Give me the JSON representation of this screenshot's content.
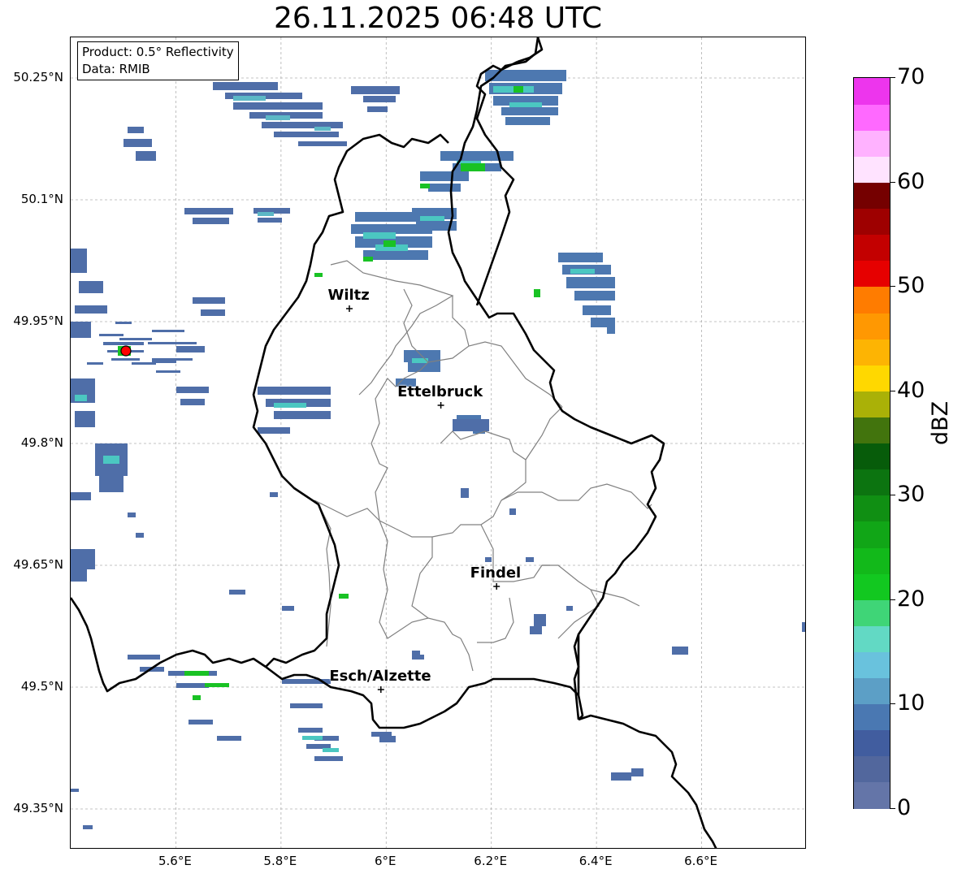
{
  "title": "26.11.2025 06:48 UTC",
  "info": {
    "product": "Product: 0.5° Reflectivity",
    "data": "Data: RMIB"
  },
  "axes": {
    "lat_ticks": [
      {
        "value": 50.25,
        "label": "50.25°N"
      },
      {
        "value": 50.1,
        "label": "50.1°N"
      },
      {
        "value": 49.95,
        "label": "49.95°N"
      },
      {
        "value": 49.8,
        "label": "49.8°N"
      },
      {
        "value": 49.65,
        "label": "49.65°N"
      },
      {
        "value": 49.5,
        "label": "49.5°N"
      },
      {
        "value": 49.35,
        "label": "49.35°N"
      }
    ],
    "lon_ticks": [
      {
        "value": 5.6,
        "label": "5.6°E"
      },
      {
        "value": 5.8,
        "label": "5.8°E"
      },
      {
        "value": 6.0,
        "label": "6°E"
      },
      {
        "value": 6.2,
        "label": "6.2°E"
      },
      {
        "value": 6.4,
        "label": "6.4°E"
      },
      {
        "value": 6.6,
        "label": "6.6°E"
      }
    ],
    "lon_range": [
      5.4,
      6.8
    ],
    "lat_range": [
      49.3,
      50.3
    ],
    "grid": true
  },
  "cities": [
    {
      "name": "Wiltz",
      "lon": 5.93,
      "lat": 49.966
    },
    {
      "name": "Ettelbruck",
      "lon": 6.104,
      "lat": 49.847
    },
    {
      "name": "Findel",
      "lon": 6.21,
      "lat": 49.624
    },
    {
      "name": "Esch/Alzette",
      "lon": 5.99,
      "lat": 49.497
    }
  ],
  "radar_site": {
    "lon": 5.505,
    "lat": 49.914,
    "color": "#ff0000"
  },
  "colorbar": {
    "label": "dBZ",
    "min": 0,
    "max": 70,
    "ticks": [
      "0",
      "10",
      "20",
      "30",
      "40",
      "50",
      "60",
      "70"
    ],
    "colors": [
      "#6475a8",
      "#52679d",
      "#415d9f",
      "#4a78b2",
      "#5c9fc6",
      "#69c2dd",
      "#62d9c4",
      "#3fd577",
      "#12c820",
      "#12b91a",
      "#11a617",
      "#108f13",
      "#0c7410",
      "#075c0a",
      "#42740d",
      "#aab107",
      "#ffd800",
      "#fdb403",
      "#ff9802",
      "#ff7c00",
      "#e60000",
      "#c30000",
      "#9e0000",
      "#750000",
      "#ffe3ff",
      "#ffb2ff",
      "#ff69ff",
      "#ed35ed"
    ]
  },
  "legend_colors": {
    "border_country": "#000000",
    "border_canton": "#808080"
  }
}
